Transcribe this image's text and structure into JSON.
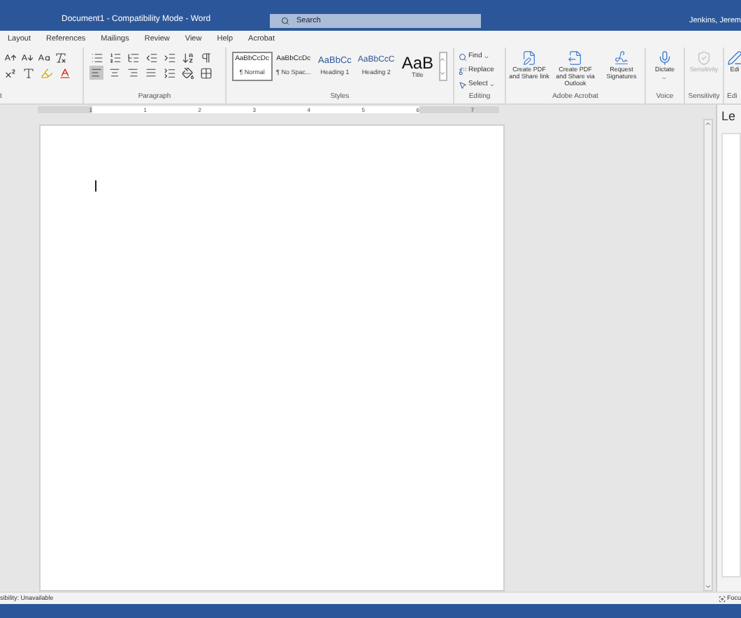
{
  "window": {
    "title": "Document1  -  Compatibility Mode  -  Word",
    "search": {
      "placeholder": "Search"
    },
    "user": "Jenkins, Jerem"
  },
  "tabs": [
    {
      "label": "Layout",
      "selected": false
    },
    {
      "label": "References",
      "selected": false
    },
    {
      "label": "Mailings",
      "selected": false
    },
    {
      "label": "Review",
      "selected": false
    },
    {
      "label": "View",
      "selected": false
    },
    {
      "label": "Help",
      "selected": false
    },
    {
      "label": "Acrobat",
      "selected": false
    }
  ],
  "ribbon": {
    "font_group_label": "t",
    "paragraph_label": "Paragraph",
    "alignment": [
      {
        "selected": true
      },
      {
        "selected": false
      },
      {
        "selected": false
      },
      {
        "selected": false
      }
    ],
    "styles_label": "Styles",
    "styles": [
      {
        "preview": "AaBbCcDc",
        "name": "¶ Normal",
        "kind": "body",
        "selected": true
      },
      {
        "preview": "AaBbCcDc",
        "name": "¶ No Spac...",
        "kind": "body",
        "selected": false
      },
      {
        "preview": "AaBbCc",
        "name": "Heading 1",
        "kind": "heading1",
        "selected": false
      },
      {
        "preview": "AaBbCcC",
        "name": "Heading 2",
        "kind": "heading2",
        "selected": false
      },
      {
        "preview": "AaB",
        "name": "Title",
        "kind": "title",
        "selected": false
      }
    ],
    "editing_label": "Editing",
    "editing": [
      {
        "label": "Find",
        "kind": "find"
      },
      {
        "label": "Replace",
        "kind": "replace"
      },
      {
        "label": "Select",
        "kind": "select"
      }
    ],
    "acrobat_label": "Adobe Acrobat",
    "acrobat": [
      {
        "label": "Create PDF and Share link",
        "kind": "share"
      },
      {
        "label": "Create PDF and Share via Outlook",
        "kind": "outlook"
      },
      {
        "label": "Request Signatures",
        "kind": "sign"
      }
    ],
    "voice_label": "Voice",
    "dictate": "Dictate",
    "sensitivity_label": "Sensitivity",
    "sensitivity": {
      "label": "Sensitivity",
      "disabled": true
    },
    "editor_label": "Edi",
    "editor": "Edi"
  },
  "ruler": {
    "numbers": [
      "1",
      "1",
      "2",
      "3",
      "4",
      "5",
      "6",
      "7"
    ]
  },
  "side_pane": {
    "title": "Le"
  },
  "status_bar": {
    "accessibility": "sibility: Unavailable",
    "focus": "Focu"
  }
}
